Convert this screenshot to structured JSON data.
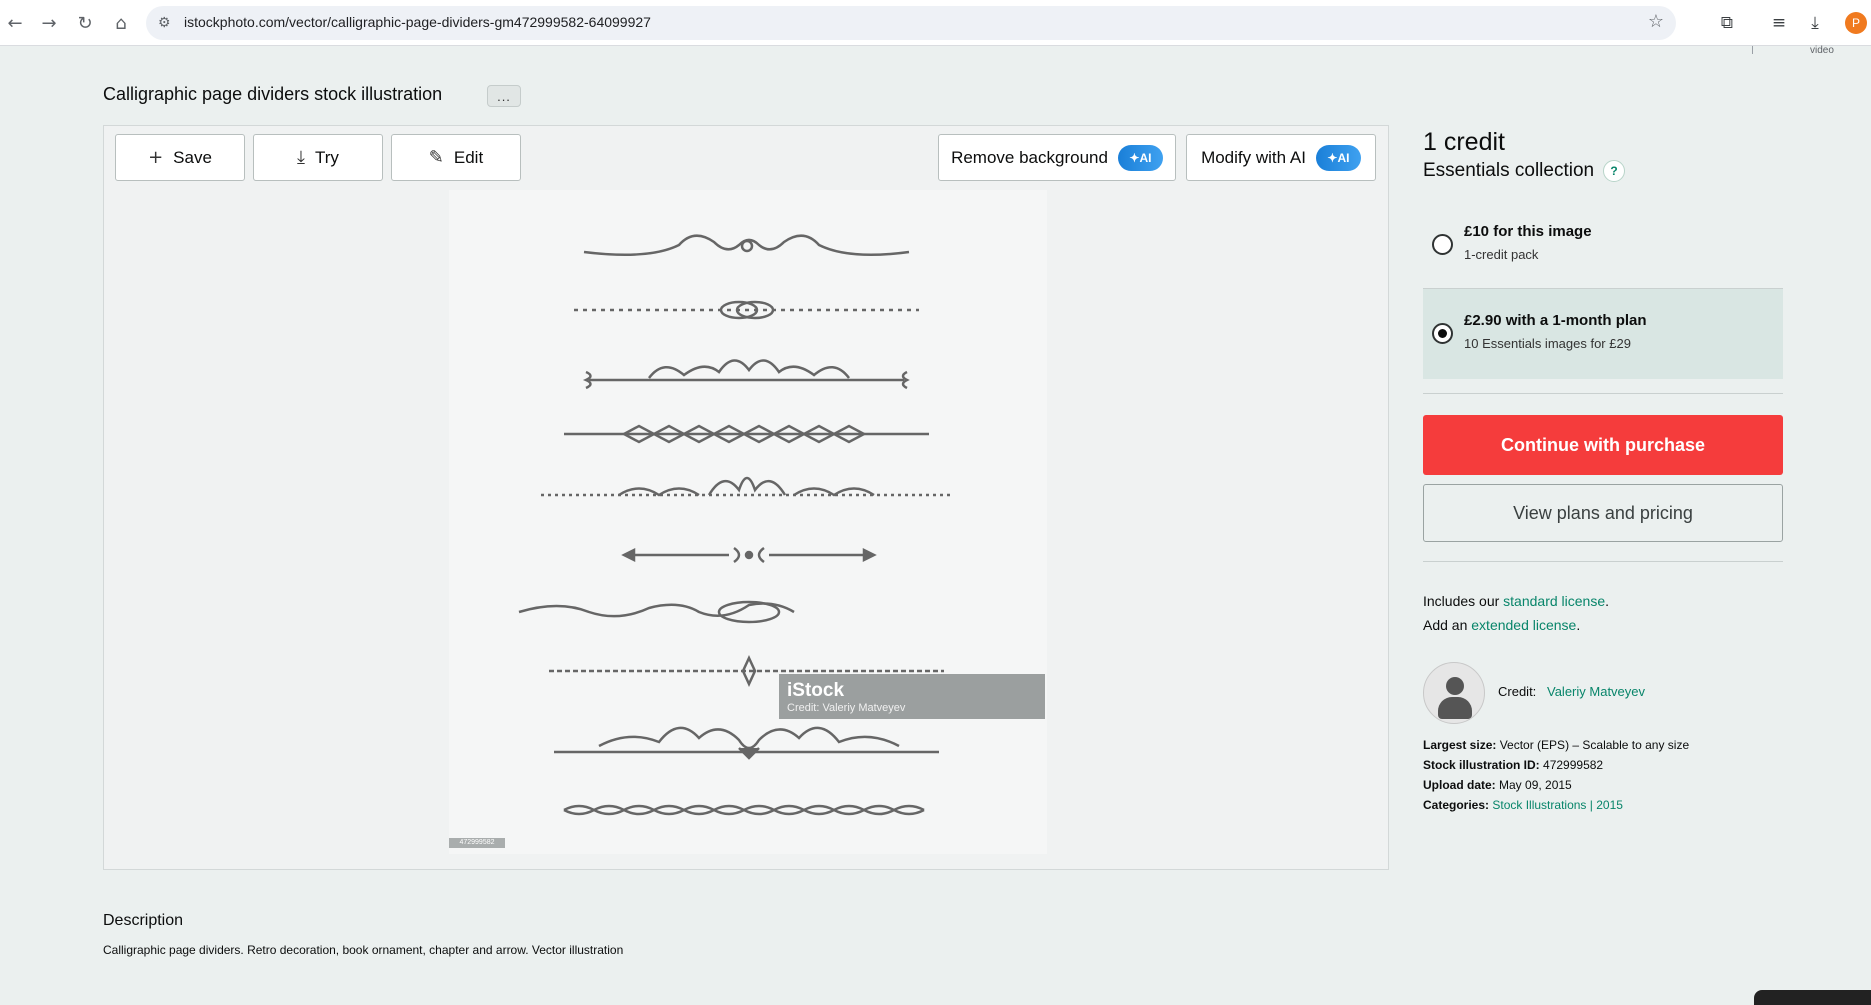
{
  "browser": {
    "url": "istockphoto.com/vector/calligraphic-page-dividers-gm472999582-64099927",
    "profile_initial": "P",
    "video_label": "video"
  },
  "page": {
    "title": "Calligraphic page dividers stock illustration",
    "more_label": "..."
  },
  "toolbar": {
    "save_label": "Save",
    "try_label": "Try",
    "edit_label": "Edit",
    "remove_bg_label": "Remove background",
    "modify_ai_label": "Modify with AI",
    "ai_badge": "AI"
  },
  "image": {
    "watermark_logo": "iStock",
    "watermark_credit": "Credit: Valeriy Matveyev",
    "id_tag": "472999582"
  },
  "purchase": {
    "credit_title": "1 credit",
    "collection": "Essentials collection",
    "help_label": "?",
    "options": [
      {
        "title": "£10 for this image",
        "subtitle": "1-credit pack",
        "selected": false
      },
      {
        "title": "£2.90 with a 1-month plan",
        "subtitle": "10 Essentials images for £29",
        "selected": true
      }
    ],
    "continue_label": "Continue with purchase",
    "plans_label": "View plans and pricing"
  },
  "license": {
    "includes_prefix": "Includes our ",
    "standard_link": "standard license",
    "includes_suffix": ".",
    "add_prefix": "Add an ",
    "extended_link": "extended license",
    "add_suffix": "."
  },
  "credit": {
    "label": "Credit:",
    "name": "Valeriy Matveyev"
  },
  "meta": {
    "largest_size_label": "Largest size:",
    "largest_size_value": "Vector (EPS) – Scalable to any size",
    "id_label": "Stock illustration ID:",
    "id_value": "472999582",
    "upload_label": "Upload date:",
    "upload_value": "May 09, 2015",
    "categories_label": "Categories:",
    "category_1": "Stock Illustrations",
    "category_sep": "|",
    "category_2": "2015"
  },
  "description": {
    "title": "Description",
    "text": "Calligraphic page dividers. Retro decoration, book ornament, chapter and arrow. Vector illustration"
  },
  "colors": {
    "accent_red": "#f53c3c",
    "link_green": "#08856a",
    "background": "#ebf0ef"
  }
}
